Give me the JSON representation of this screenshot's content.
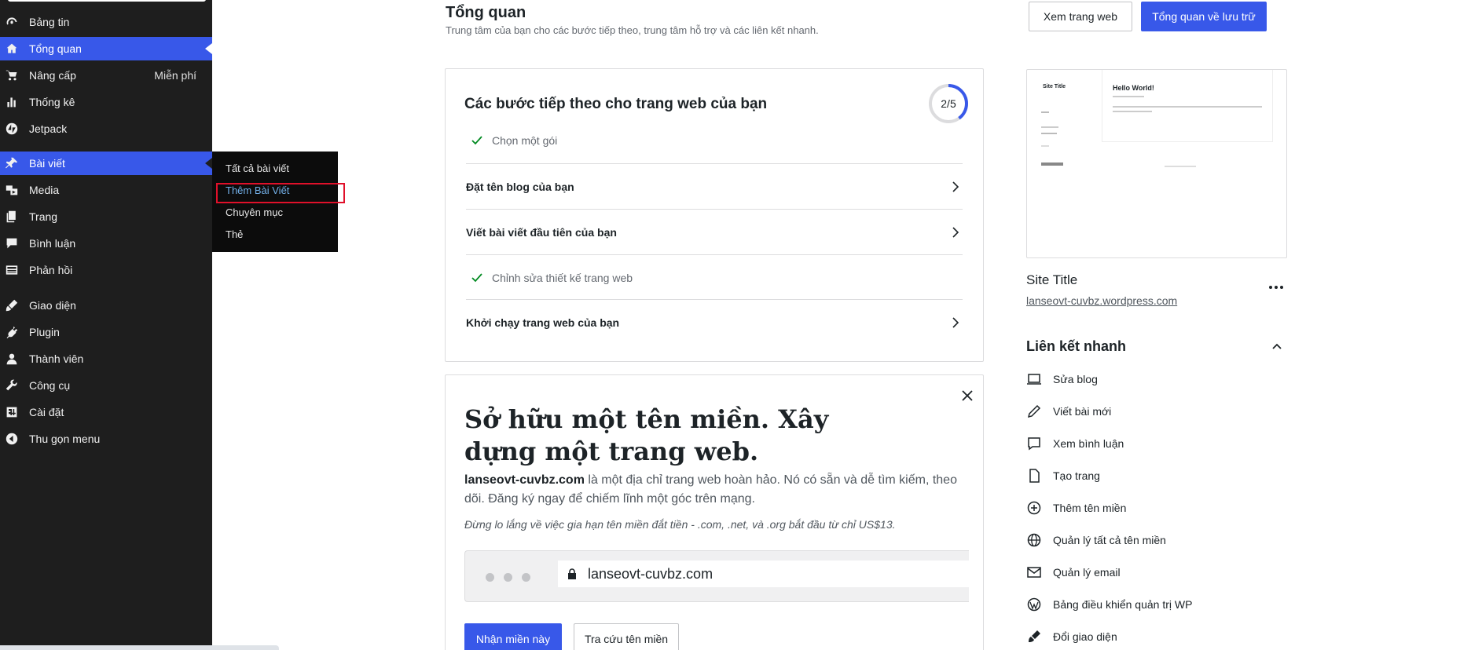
{
  "sidebar": {
    "items": [
      {
        "label": "Bảng tin",
        "icon": "dashboard-icon"
      },
      {
        "label": "Tổng quan",
        "icon": "home-icon",
        "active": true
      },
      {
        "label": "Nâng cấp",
        "icon": "cart-icon",
        "extra": "Miễn phí"
      },
      {
        "label": "Thống kê",
        "icon": "stats-icon"
      },
      {
        "label": "Jetpack",
        "icon": "jetpack-icon"
      },
      {
        "label": "Bài viết",
        "icon": "pin-icon",
        "active": true
      },
      {
        "label": "Media",
        "icon": "media-icon"
      },
      {
        "label": "Trang",
        "icon": "pages-icon"
      },
      {
        "label": "Bình luận",
        "icon": "comments-icon"
      },
      {
        "label": "Phản hồi",
        "icon": "feedback-icon"
      },
      {
        "label": "Giao diện",
        "icon": "appearance-icon"
      },
      {
        "label": "Plugin",
        "icon": "plugin-icon"
      },
      {
        "label": "Thành viên",
        "icon": "users-icon"
      },
      {
        "label": "Công cụ",
        "icon": "tools-icon"
      },
      {
        "label": "Cài đặt",
        "icon": "settings-icon"
      },
      {
        "label": "Thu gọn menu",
        "icon": "collapse-icon"
      }
    ],
    "posts_submenu": [
      "Tất cả bài viết",
      "Thêm Bài Viết",
      "Chuyên mục",
      "Thẻ"
    ]
  },
  "header": {
    "title": "Tổng quan",
    "subtitle": "Trung tâm của bạn cho các bước tiếp theo, trung tâm hỗ trợ và các liên kết nhanh.",
    "view_site": "Xem trang web",
    "storage_overview": "Tổng quan về lưu trữ"
  },
  "next_steps": {
    "title": "Các bước tiếp theo cho trang web của bạn",
    "progress": "2/5",
    "progress_fraction": 0.4,
    "tasks": [
      {
        "label": "Chọn một gói",
        "done": true
      },
      {
        "label": "Đặt tên blog của bạn",
        "done": false
      },
      {
        "label": "Viết bài viết đầu tiên của bạn",
        "done": false
      },
      {
        "label": "Chỉnh sửa thiết kế trang web",
        "done": true
      },
      {
        "label": "Khởi chạy trang web của bạn",
        "done": false
      }
    ]
  },
  "domain_card": {
    "heading": "Sở hữu một tên miền. Xây dựng một trang web.",
    "domain": "lanseovt-cuvbz.com",
    "text": " là một địa chỉ trang web hoàn hảo. Nó có sẵn và dễ tìm kiếm, theo dõi. Đăng ký ngay để chiếm lĩnh một góc trên mạng.",
    "note": "Đừng lo lắng về việc gia hạn tên miền đắt tiền - .com, .net, và .org bắt đầu từ chỉ US$13.",
    "url": "lanseovt-cuvbz.com",
    "claim_button": "Nhận miền này",
    "search_button": "Tra cứu tên miền"
  },
  "site": {
    "preview_title": "Site Title",
    "preview_heading": "Hello World!",
    "title": "Site Title",
    "url": "lanseovt-cuvbz.wordpress.com"
  },
  "quick_links": {
    "title": "Liên kết nhanh",
    "items": [
      {
        "label": "Sửa blog",
        "icon": "laptop-icon"
      },
      {
        "label": "Viết bài mới",
        "icon": "pencil-icon"
      },
      {
        "label": "Xem bình luận",
        "icon": "comment-icon"
      },
      {
        "label": "Tạo trang",
        "icon": "page-icon"
      },
      {
        "label": "Thêm tên miền",
        "icon": "plus-circle-icon"
      },
      {
        "label": "Quản lý tất cả tên miền",
        "icon": "globe-icon"
      },
      {
        "label": "Quản lý email",
        "icon": "mail-icon"
      },
      {
        "label": "Bảng điều khiển quản trị WP",
        "icon": "wordpress-icon"
      },
      {
        "label": "Đổi giao diện",
        "icon": "brush-icon"
      }
    ]
  },
  "colors": {
    "accent": "#3858e9",
    "sidebar_bg": "#1e1e1e",
    "check": "#008a20",
    "highlight_box": "#e0102a"
  }
}
